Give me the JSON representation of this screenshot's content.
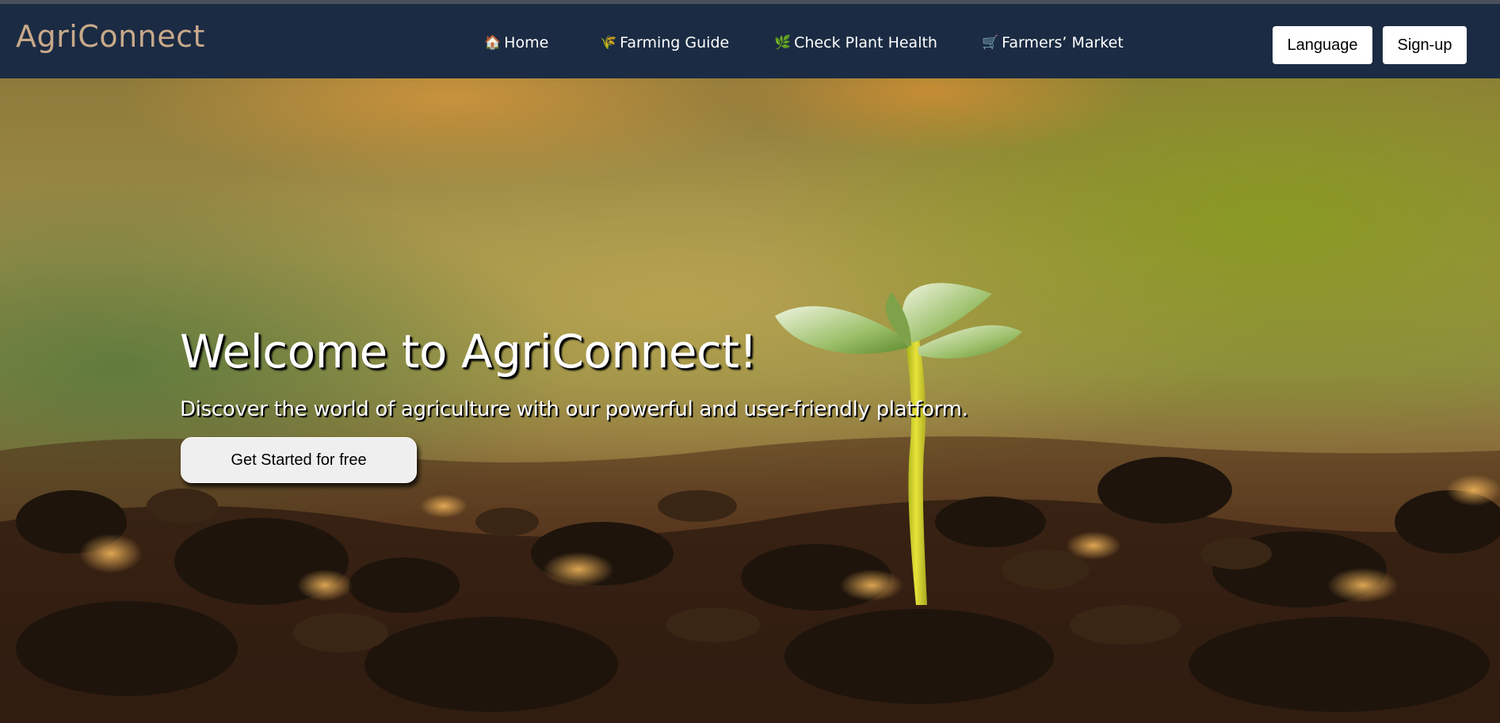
{
  "header": {
    "logo": "AgriConnect",
    "nav": [
      {
        "icon": "🏠",
        "icon_name": "house-icon",
        "label": "Home"
      },
      {
        "icon": "🌾",
        "icon_name": "corn-icon",
        "label": "Farming Guide"
      },
      {
        "icon": "🌿",
        "icon_name": "herb-icon",
        "label": "Check Plant Health"
      },
      {
        "icon": "🛒",
        "icon_name": "cart-icon",
        "label": "Farmers’ Market"
      }
    ],
    "language_label": "Language",
    "signup_label": "Sign-up"
  },
  "hero": {
    "title": "Welcome to AgriConnect!",
    "subtitle": "Discover the world of agriculture with our powerful and user-friendly platform.",
    "cta_label": "Get Started for free"
  },
  "colors": {
    "navbar_bg": "#1b2b43",
    "logo": "#c8a98a",
    "nav_text": "#ffffff",
    "button_bg": "#ffffff",
    "cta_bg": "#f0eff0"
  }
}
